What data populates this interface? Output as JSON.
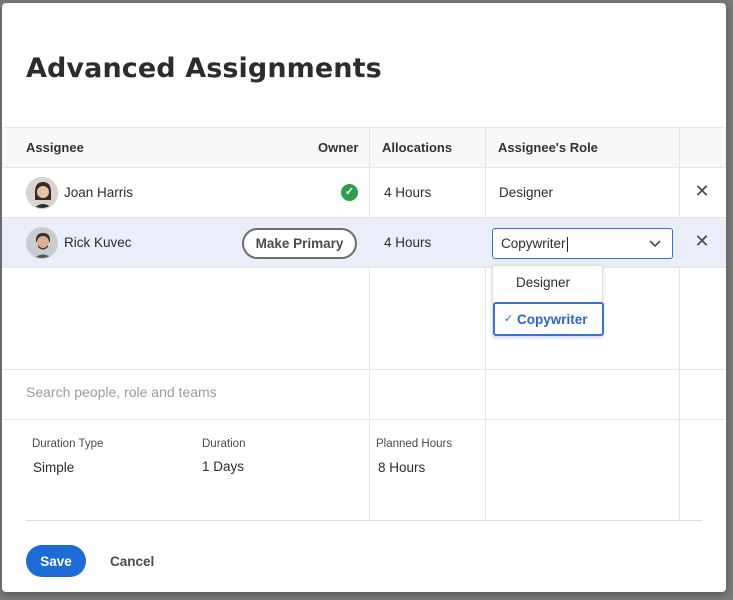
{
  "dialog": {
    "title": "Advanced Assignments"
  },
  "columns": {
    "assignee": "Assignee",
    "owner": "Owner",
    "allocations": "Allocations",
    "role": "Assignee's Role"
  },
  "rows": [
    {
      "name": "Joan Harris",
      "owner": true,
      "allocation": "4 Hours",
      "role": "Designer"
    },
    {
      "name": "Rick Kuvec",
      "owner": false,
      "make_primary_label": "Make Primary",
      "allocation": "4 Hours",
      "role": "Copywriter"
    }
  ],
  "role_dropdown": {
    "options": [
      "Designer",
      "Copywriter"
    ],
    "selected": "Copywriter",
    "check": "✓"
  },
  "search": {
    "placeholder": "Search people, role and teams"
  },
  "duration": {
    "type_label": "Duration Type",
    "type_value": "Simple",
    "duration_label": "Duration",
    "duration_value": "1 Days",
    "planned_label": "Planned Hours",
    "planned_value": "8 Hours"
  },
  "footer": {
    "save_label": "Save",
    "cancel_label": "Cancel"
  },
  "colors": {
    "accent": "#1e6bd6",
    "owner_check": "#2d9d4b",
    "selected_row": "#e9eef8"
  },
  "icons": {
    "owner": "checkmark-circle-icon",
    "remove": "close-icon",
    "select": "chevron-down-icon"
  }
}
